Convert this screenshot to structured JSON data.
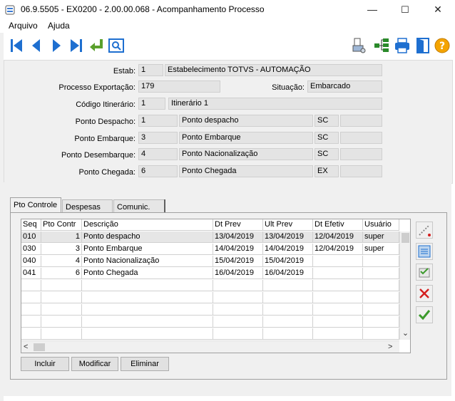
{
  "window": {
    "title": "06.9.5505 - EX0200 - 2.00.00.068 - Acompanhamento Processo",
    "minimize": "—",
    "maximize": "☐",
    "close": "✕"
  },
  "menu": {
    "arquivo": "Arquivo",
    "ajuda": "Ajuda"
  },
  "form": {
    "estab_label": "Estab:",
    "estab_code": "1",
    "estab_name": "Estabelecimento TOTVS - AUTOMAÇÃO",
    "processo_label": "Processo Exportação:",
    "processo_value": "179",
    "situacao_label": "Situação:",
    "situacao_value": "Embarcado",
    "itinerario_label": "Código Itinerário:",
    "itinerario_code": "1",
    "itinerario_name": "Itinerário 1",
    "despacho_label": "Ponto Despacho:",
    "despacho_code": "1",
    "despacho_name": "Ponto despacho",
    "despacho_uf": "SC",
    "embarque_label": "Ponto Embarque:",
    "embarque_code": "3",
    "embarque_name": "Ponto Embarque",
    "embarque_uf": "SC",
    "desembarque_label": "Ponto Desembarque:",
    "desembarque_code": "4",
    "desembarque_name": "Ponto Nacionalização",
    "desembarque_uf": "SC",
    "chegada_label": "Ponto Chegada:",
    "chegada_code": "6",
    "chegada_name": "Ponto Chegada",
    "chegada_uf": "EX"
  },
  "tabs": {
    "pto_controle": "Pto Controle",
    "despesas": "Despesas",
    "comunic": "Comunic."
  },
  "grid": {
    "headers": {
      "seq": "Seq",
      "pto": "Pto Contr",
      "desc": "Descrição",
      "dtprev": "Dt Prev",
      "ultprev": "Ult Prev",
      "dtefetiv": "Dt Efetiv",
      "usuario": "Usuário"
    },
    "rows": [
      {
        "seq": "010",
        "pto": "1",
        "desc": "Ponto despacho",
        "dtprev": "13/04/2019",
        "ultprev": "13/04/2019",
        "dtefetiv": "12/04/2019",
        "usuario": "super"
      },
      {
        "seq": "030",
        "pto": "3",
        "desc": "Ponto Embarque",
        "dtprev": "14/04/2019",
        "ultprev": "14/04/2019",
        "dtefetiv": "12/04/2019",
        "usuario": "super"
      },
      {
        "seq": "040",
        "pto": "4",
        "desc": "Ponto Nacionalização",
        "dtprev": "15/04/2019",
        "ultprev": "15/04/2019",
        "dtefetiv": "",
        "usuario": ""
      },
      {
        "seq": "041",
        "pto": "6",
        "desc": "Ponto Chegada",
        "dtprev": "16/04/2019",
        "ultprev": "16/04/2019",
        "dtefetiv": "",
        "usuario": ""
      }
    ]
  },
  "buttons": {
    "incluir": "Incluir",
    "modificar": "Modificar",
    "eliminar": "Eliminar"
  },
  "scroll": {
    "up": "▲",
    "down": "⌄",
    "left": "<",
    "right": ">"
  },
  "side_icons": [
    "edit-row-icon",
    "pick-icon",
    "copy-icon",
    "cancel-icon",
    "confirm-icon"
  ],
  "colors": {
    "toolbar_blue": "#1e6fd0",
    "arrow_green": "#5aa02c",
    "cancel_red": "#d42020",
    "confirm_green": "#3c9a2c"
  }
}
